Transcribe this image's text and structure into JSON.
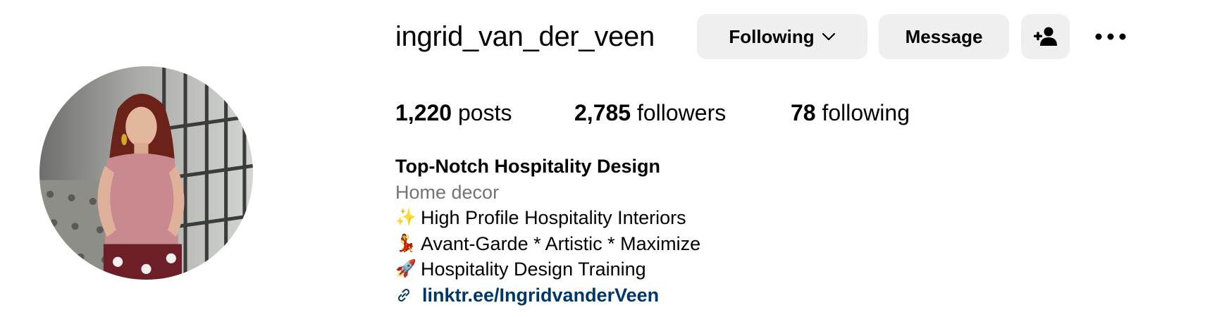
{
  "profile": {
    "username": "ingrid_van_der_veen",
    "avatar_alt": "profile photo"
  },
  "actions": {
    "following_label": "Following",
    "following_icon": "chevron-down-icon",
    "message_label": "Message",
    "add_user_icon": "person-add-icon",
    "more_icon": "more-horizontal-icon"
  },
  "stats": {
    "posts": {
      "count": "1,220",
      "label": "posts"
    },
    "followers": {
      "count": "2,785",
      "label": "followers"
    },
    "following": {
      "count": "78",
      "label": "following"
    }
  },
  "bio": {
    "name": "Top-Notch Hospitality Design",
    "category": "Home decor",
    "lines": [
      {
        "emoji": "✨",
        "text": "High Profile Hospitality Interiors"
      },
      {
        "emoji": "💃",
        "text": "Avant-Garde * Artistic * Maximize"
      },
      {
        "emoji": "🚀",
        "text": "Hospitality Design Training"
      }
    ],
    "link_icon": "link-icon",
    "link": "linktr.ee/IngridvanderVeen"
  },
  "colors": {
    "button_bg": "#efefef",
    "link": "#00376b",
    "category_text": "#737373"
  }
}
